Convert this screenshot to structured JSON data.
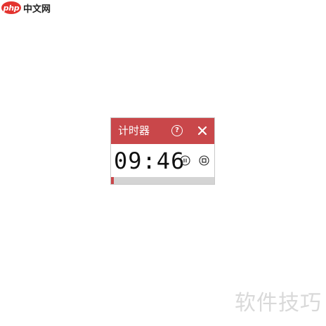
{
  "site_logo": {
    "badge_text": "php",
    "name": "中文网",
    "badge_color": "#e3342f"
  },
  "timer": {
    "title": "计时器",
    "help_label": "?",
    "time": "09:46",
    "progress": 0.03,
    "accent_color": "#c9474a",
    "icons": {
      "help": "help-circle-icon",
      "close": "close-icon",
      "pause": "pause-circle-icon",
      "stop": "stop-circle-icon"
    }
  },
  "watermark": {
    "text": "软件技巧"
  }
}
